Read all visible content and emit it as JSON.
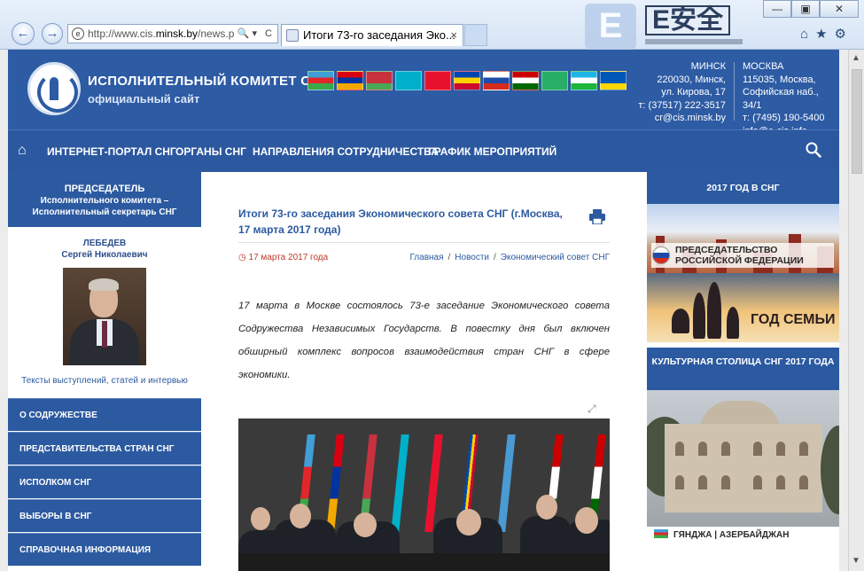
{
  "browser": {
    "address": {
      "prefix": "http://www.cis.",
      "domain": "minsk.by",
      "suffix": "/news.p"
    },
    "tab_title": "Итоги 73-го заседания Эко...",
    "tab_close": "×",
    "watermark": {
      "letter": "E",
      "text": "E安全"
    }
  },
  "header": {
    "title": "ИСПОЛНИТЕЛЬНЫЙ КОМИТЕТ СНГ",
    "subtitle": "официальный сайт",
    "flags": [
      {
        "country": "Azerbaijan",
        "colors": [
          "#3f9fd6",
          "#e2262a",
          "#3aaa48"
        ]
      },
      {
        "country": "Armenia",
        "colors": [
          "#d90012",
          "#0033a0",
          "#f2a800"
        ]
      },
      {
        "country": "Belarus",
        "colors": [
          "#c8313e",
          "#c8313e",
          "#4aa657"
        ]
      },
      {
        "country": "Kazakhstan",
        "colors": [
          "#00afca",
          "#00afca",
          "#00afca"
        ]
      },
      {
        "country": "Kyrgyzstan",
        "colors": [
          "#e8112d",
          "#e8112d",
          "#e8112d"
        ]
      },
      {
        "country": "Moldova",
        "colors": [
          "#0046ae",
          "#ffd200",
          "#cc092f"
        ]
      },
      {
        "country": "Russia",
        "colors": [
          "#ffffff",
          "#1c4ca8",
          "#d52b1e"
        ]
      },
      {
        "country": "Tajikistan",
        "colors": [
          "#cc0000",
          "#ffffff",
          "#006600"
        ]
      },
      {
        "country": "Turkmenistan",
        "colors": [
          "#28ae66",
          "#28ae66",
          "#28ae66"
        ]
      },
      {
        "country": "Uzbekistan",
        "colors": [
          "#1eb5e6",
          "#ffffff",
          "#1eb53a"
        ]
      },
      {
        "country": "Ukraine",
        "colors": [
          "#0057b7",
          "#0057b7",
          "#ffd700"
        ]
      }
    ],
    "minsk": {
      "city": "МИНСК",
      "address1": "220030, Минск,",
      "address2": "ул. Кирова, 17",
      "phone": "т: (37517) 222-3517",
      "email": "cr@cis.minsk.by"
    },
    "moscow": {
      "city": "МОСКВА",
      "address1": "115035, Москва,",
      "address2": "Софийская наб., 34/1",
      "phone": "т: (7495) 190-5400",
      "email": "info@e-cis.info"
    }
  },
  "menu": {
    "items": [
      "ИНТЕРНЕТ-ПОРТАЛ СНГ",
      "ОРГАНЫ СНГ",
      "НАПРАВЛЕНИЯ СОТРУДНИЧЕСТВА",
      "ГРАФИК МЕРОПРИЯТИЙ"
    ]
  },
  "left": {
    "chair_title": "ПРЕДСЕДАТЕЛЬ",
    "chair_role1": "Исполнительного комитета –",
    "chair_role2": "Исполнительный секретарь СНГ",
    "surname": "ЛЕБЕДЕВ",
    "given_names": "Сергей Николаевич",
    "speeches_link": "Тексты выступлений, статей и интервью",
    "nav": [
      "О СОДРУЖЕСТВЕ",
      "ПРЕДСТАВИТЕЛЬСТВА СТРАН СНГ",
      "ИСПОЛКОМ СНГ",
      "ВЫБОРЫ В СНГ",
      "СПРАВОЧНАЯ ИНФОРМАЦИЯ"
    ]
  },
  "article": {
    "title": "Итоги 73-го заседания Экономического совета СНГ (г.Москва, 17 марта 2017 года)",
    "date": "17 марта 2017 года",
    "breadcrumbs": [
      "Главная",
      "Новости",
      "Экономический совет СНГ"
    ],
    "crumb_sep": "/",
    "lead": "17 марта в Москве состоялось 73-е заседание Экономического совета Содружества Независимых Государств. В повестку дня был включен обширный комплекс вопросов взаимодействия стран СНГ в сфере экономики."
  },
  "right": {
    "year_header": "2017 ГОД В СНГ",
    "rf_banner": "ПРЕДСЕДАТЕЛЬСТВО\nРОССИЙСКОЙ ФЕДЕРАЦИИ",
    "rf_line1": "ПРЕДСЕДАТЕЛЬСТВО",
    "rf_line2": "РОССИЙСКОЙ ФЕДЕРАЦИИ",
    "family_banner": "ГОД СЕМЬИ",
    "culture_header": "КУЛЬТУРНАЯ СТОЛИЦА СНГ 2017 ГОДА",
    "culture_caption": "ГЯНДЖА | АЗЕРБАЙДЖАН"
  }
}
